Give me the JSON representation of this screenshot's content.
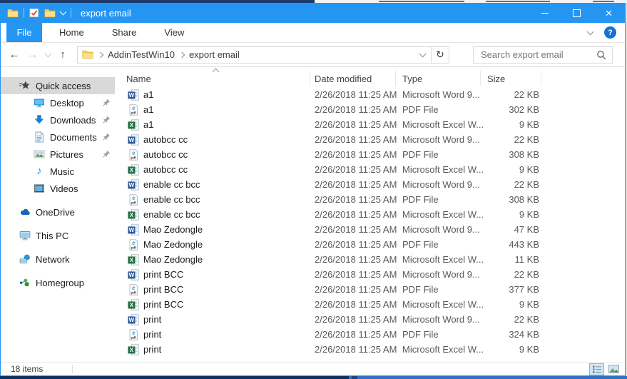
{
  "titlebar": {
    "title": "export email"
  },
  "ribbon": {
    "tabs": [
      "File",
      "Home",
      "Share",
      "View"
    ],
    "active_tab": "File"
  },
  "address": {
    "breadcrumb": [
      "AddinTestWin10",
      "export email"
    ],
    "search_placeholder": "Search export email"
  },
  "sidebar": {
    "items": [
      {
        "label": "Quick access",
        "icon": "star",
        "level": 0,
        "selected": true
      },
      {
        "label": "Desktop",
        "icon": "desktop",
        "level": 1,
        "pinned": true
      },
      {
        "label": "Downloads",
        "icon": "downloads",
        "level": 1,
        "pinned": true
      },
      {
        "label": "Documents",
        "icon": "documents",
        "level": 1,
        "pinned": true
      },
      {
        "label": "Pictures",
        "icon": "pictures",
        "level": 1,
        "pinned": true
      },
      {
        "label": "Music",
        "icon": "music",
        "level": 1
      },
      {
        "label": "Videos",
        "icon": "videos",
        "level": 1
      },
      {
        "label": "OneDrive",
        "icon": "onedrive",
        "level": 0,
        "group_start": true
      },
      {
        "label": "This PC",
        "icon": "thispc",
        "level": 0,
        "group_start": true
      },
      {
        "label": "Network",
        "icon": "network",
        "level": 0,
        "group_start": true
      },
      {
        "label": "Homegroup",
        "icon": "homegroup",
        "level": 0,
        "group_start": true
      }
    ]
  },
  "filelist": {
    "columns": [
      "Name",
      "Date modified",
      "Type",
      "Size"
    ],
    "sort_column": "Name",
    "sort_direction": "ascending",
    "rows": [
      {
        "name": "a1",
        "icon": "word",
        "date": "2/26/2018 11:25 AM",
        "type": "Microsoft Word 9...",
        "size": "22 KB"
      },
      {
        "name": "a1",
        "icon": "pdf",
        "date": "2/26/2018 11:25 AM",
        "type": "PDF File",
        "size": "302 KB"
      },
      {
        "name": "a1",
        "icon": "excel",
        "date": "2/26/2018 11:25 AM",
        "type": "Microsoft Excel W...",
        "size": "9 KB"
      },
      {
        "name": "autobcc cc",
        "icon": "word",
        "date": "2/26/2018 11:25 AM",
        "type": "Microsoft Word 9...",
        "size": "22 KB"
      },
      {
        "name": "autobcc cc",
        "icon": "pdf",
        "date": "2/26/2018 11:25 AM",
        "type": "PDF File",
        "size": "308 KB"
      },
      {
        "name": "autobcc cc",
        "icon": "excel",
        "date": "2/26/2018 11:25 AM",
        "type": "Microsoft Excel W...",
        "size": "9 KB"
      },
      {
        "name": "enable cc bcc",
        "icon": "word",
        "date": "2/26/2018 11:25 AM",
        "type": "Microsoft Word 9...",
        "size": "22 KB"
      },
      {
        "name": "enable cc bcc",
        "icon": "pdf",
        "date": "2/26/2018 11:25 AM",
        "type": "PDF File",
        "size": "308 KB"
      },
      {
        "name": "enable cc bcc",
        "icon": "excel",
        "date": "2/26/2018 11:25 AM",
        "type": "Microsoft Excel W...",
        "size": "9 KB"
      },
      {
        "name": "Mao Zedongle",
        "icon": "word",
        "date": "2/26/2018 11:25 AM",
        "type": "Microsoft Word 9...",
        "size": "47 KB"
      },
      {
        "name": "Mao Zedongle",
        "icon": "pdf",
        "date": "2/26/2018 11:25 AM",
        "type": "PDF File",
        "size": "443 KB"
      },
      {
        "name": "Mao Zedongle",
        "icon": "excel",
        "date": "2/26/2018 11:25 AM",
        "type": "Microsoft Excel W...",
        "size": "11 KB"
      },
      {
        "name": "print BCC",
        "icon": "word",
        "date": "2/26/2018 11:25 AM",
        "type": "Microsoft Word 9...",
        "size": "22 KB"
      },
      {
        "name": "print BCC",
        "icon": "pdf",
        "date": "2/26/2018 11:25 AM",
        "type": "PDF File",
        "size": "377 KB"
      },
      {
        "name": "print BCC",
        "icon": "excel",
        "date": "2/26/2018 11:25 AM",
        "type": "Microsoft Excel W...",
        "size": "9 KB"
      },
      {
        "name": "print",
        "icon": "word",
        "date": "2/26/2018 11:25 AM",
        "type": "Microsoft Word 9...",
        "size": "22 KB"
      },
      {
        "name": "print",
        "icon": "pdf",
        "date": "2/26/2018 11:25 AM",
        "type": "PDF File",
        "size": "324 KB"
      },
      {
        "name": "print",
        "icon": "excel",
        "date": "2/26/2018 11:25 AM",
        "type": "Microsoft Excel W...",
        "size": "9 KB"
      }
    ]
  },
  "statusbar": {
    "item_count": "18 items"
  },
  "colors": {
    "accent": "#2595f2",
    "sidebar_selected_bg": "#d9d9d9",
    "detail_text": "#595959",
    "word_icon": "#2b579a",
    "excel_icon": "#1f7145",
    "pdf_icon_accent": "#1e9ce0"
  },
  "icons": {
    "search-icon": "magnifier",
    "refresh-icon": "clockwise circular arrow",
    "back-icon": "left arrow",
    "forward-icon": "right arrow (disabled)",
    "up-icon": "up arrow",
    "help-icon": "blue circle question mark",
    "minimize-icon": "horizontal bar",
    "maximize-icon": "square outline",
    "close-icon": "x cross",
    "pin-icon": "gray pushpin",
    "sort-ascending-icon": "chevron up",
    "folder-icon": "yellow folder"
  }
}
